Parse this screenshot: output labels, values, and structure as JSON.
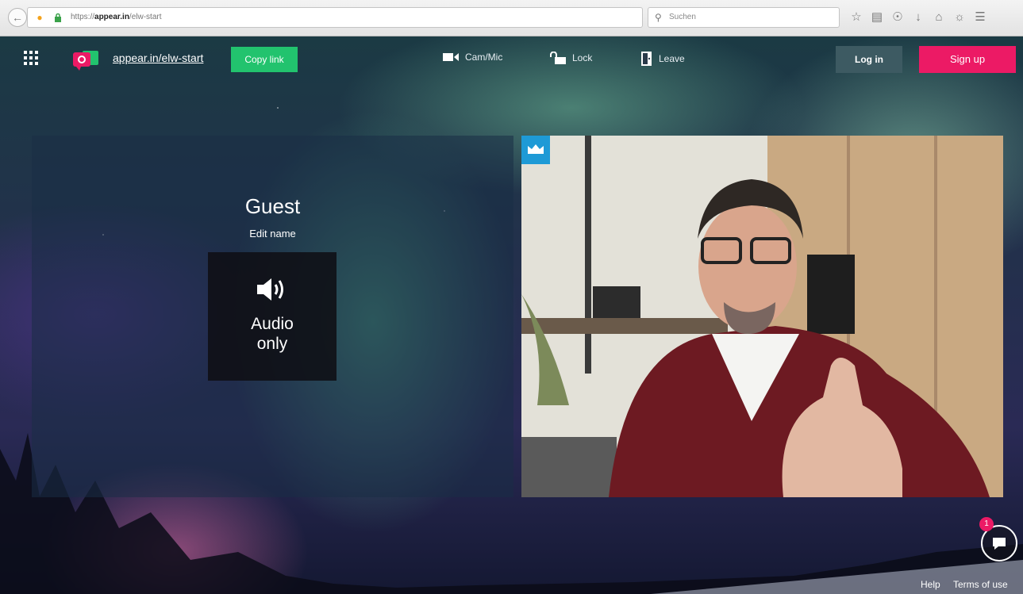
{
  "browser": {
    "url_prefix": "https://",
    "url_domain": "appear.in",
    "url_path": "/elw-start",
    "search_placeholder": "Suchen"
  },
  "header": {
    "room_link": "appear.in/elw-start",
    "copy_link_label": "Copy link",
    "cam_mic_label": "Cam/Mic",
    "lock_label": "Lock",
    "leave_label": "Leave",
    "login_label": "Log in",
    "signup_label": "Sign up"
  },
  "guest_tile": {
    "name": "Guest",
    "edit_name_label": "Edit name",
    "audio_only_line1": "Audio",
    "audio_only_line2": "only"
  },
  "chat": {
    "unread_count": "1"
  },
  "footer": {
    "help_label": "Help",
    "terms_label": "Terms of use"
  },
  "colors": {
    "copy_link": "#22c36e",
    "sign_up": "#ec1a65",
    "log_in": "#3d5a62",
    "crown_badge": "#1e9ad6"
  }
}
